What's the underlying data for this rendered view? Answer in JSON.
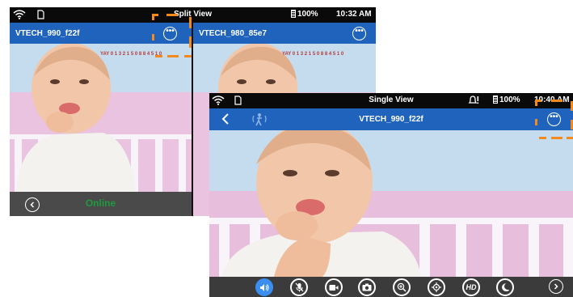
{
  "split_view": {
    "status": {
      "title": "Split View",
      "battery": "100%",
      "time": "10:32 AM"
    },
    "left_camera": {
      "name": "VTECH_990_f22f",
      "overlay_text": "YAY 0 1 3 2 1 5   0 8 8 4 5   1 0"
    },
    "right_camera": {
      "name": "VTECH_980_85e7",
      "overlay_text": "YAY 0 1 3 2 1 5   0 8 8 4 5   1 0"
    },
    "bottom": {
      "status": "Online"
    }
  },
  "single_view": {
    "status": {
      "title": "Single View",
      "battery": "100%",
      "time": "10:40 AM"
    },
    "header": {
      "camera_name": "VTECH_990_f22f"
    },
    "controls": [
      {
        "name": "speaker",
        "label": ""
      },
      {
        "name": "microphone-muted",
        "label": ""
      },
      {
        "name": "video-record",
        "label": ""
      },
      {
        "name": "snapshot",
        "label": ""
      },
      {
        "name": "zoom",
        "label": ""
      },
      {
        "name": "pan-tilt",
        "label": ""
      },
      {
        "name": "hd",
        "label": "HD"
      },
      {
        "name": "night-light",
        "label": ""
      }
    ]
  },
  "colors": {
    "header_blue": "#1f63bd",
    "highlight_orange": "#f28a1e",
    "online_green": "#1f9a3d"
  },
  "icons": [
    "wifi-icon",
    "sd-card-icon",
    "battery-icon",
    "more-options-icon",
    "back-icon",
    "motion-icon",
    "alert-icon",
    "next-icon"
  ]
}
